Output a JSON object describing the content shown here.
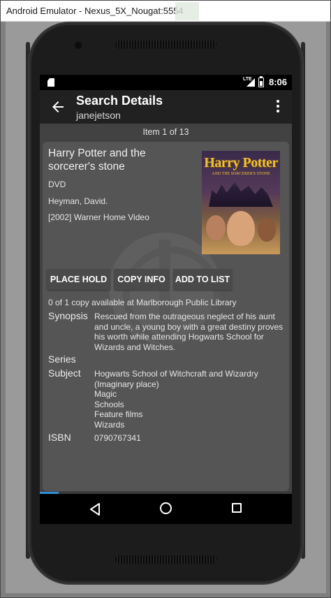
{
  "window": {
    "title": "Android Emulator - Nexus_5X_Nougat:5554"
  },
  "statusbar": {
    "time": "8:06",
    "network": "LTE",
    "icons": [
      "sim-card-icon",
      "lte-signal-icon",
      "battery-icon"
    ]
  },
  "appbar": {
    "title": "Search Details",
    "subtitle": "janejetson",
    "icons": [
      "back-arrow-icon",
      "overflow-menu-icon"
    ]
  },
  "item_count": "Item 1 of 13",
  "record": {
    "title": "Harry Potter and the sorcerer's stone",
    "format": "DVD",
    "author": "Heyman, David.",
    "publisher": "[2002] Warner Home Video",
    "cover": {
      "title": "Harry Potter",
      "subtitle": "AND THE SORCERER'S STONE"
    }
  },
  "actions": {
    "place_hold": "PLACE HOLD",
    "copy_info": "COPY INFO",
    "add_to_list": "ADD TO LIST"
  },
  "availability": "0 of 1 copy available at Marlborough Public Library",
  "details": {
    "synopsis_label": "Synopsis",
    "synopsis": "Rescued from the outrageous neglect of his aunt and uncle, a young boy with a great destiny proves his worth while attending Hogwarts School for Wizards and Witches.",
    "series_label": "Series",
    "subject_label": "Subject",
    "subjects": [
      "Hogwarts School of Witchcraft and Wizardry (Imaginary place)",
      "Magic",
      "Schools",
      "Feature films",
      "Wizards"
    ],
    "isbn_label": "ISBN",
    "isbn": "0790767341"
  },
  "progress": {
    "fraction": 0.075,
    "color": "#2f8fd6"
  },
  "navbar": {
    "icons": [
      "nav-back-icon",
      "nav-home-icon",
      "nav-recents-icon"
    ]
  }
}
